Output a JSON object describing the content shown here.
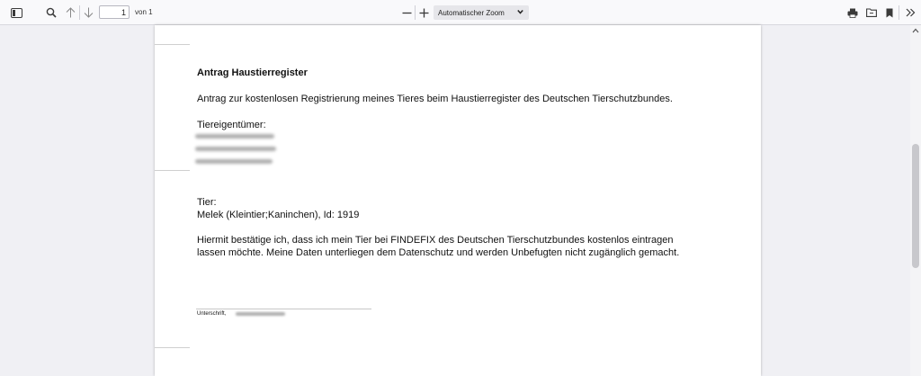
{
  "toolbar": {
    "page_number": "1",
    "page_of": "von 1",
    "zoom_value": "Automatischer Zoom"
  },
  "icons": {
    "sidebar": "sidebar-toggle-icon",
    "search": "search-icon",
    "prev": "arrow-up-icon",
    "next": "arrow-down-icon",
    "zoom_out": "minus-icon",
    "zoom_in": "plus-icon",
    "print": "printer-icon",
    "open": "folder-icon",
    "bookmark": "bookmark-icon",
    "tools": "double-chevron-right-icon"
  },
  "document": {
    "title": "Antrag Haustierregister",
    "intro": "Antrag zur kostenlosen Registrierung meines Tieres beim Haustierregister des Deutschen Tierschutzbundes.",
    "owner_label": "Tiereigentümer:",
    "animal_label": "Tier:",
    "animal_value": "Melek (Kleintier;Kaninchen), Id: 1919",
    "confirmation_line1": "Hiermit bestätige ich, dass ich mein Tier bei FINDEFIX des Deutschen Tierschutzbundes kostenlos eintragen",
    "confirmation_line2": "lassen möchte. Meine Daten unterliegen dem Datenschutz und werden Unbefugten nicht zugänglich gemacht.",
    "signature_label": "Unterschrift,"
  }
}
